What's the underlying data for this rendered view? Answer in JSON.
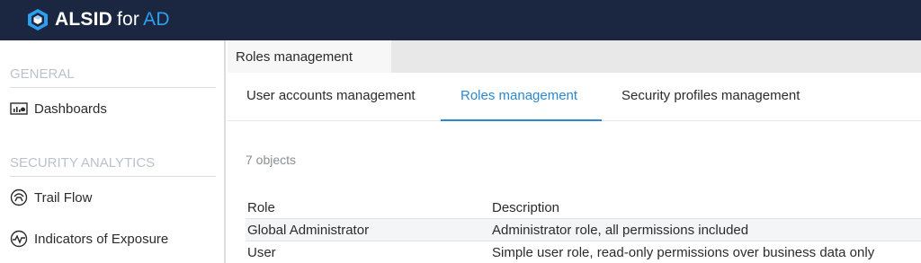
{
  "app": {
    "brand_name": "ALSID",
    "brand_for": "for",
    "brand_ad": "AD",
    "accent_color": "#2d9ff0",
    "topbar_color": "#1b2741"
  },
  "sidebar": {
    "sections": [
      {
        "title": "GENERAL"
      },
      {
        "title": "SECURITY ANALYTICS"
      }
    ],
    "items": [
      {
        "label": "Dashboards",
        "icon": "dashboard-icon"
      },
      {
        "label": "Trail Flow",
        "icon": "trail-flow-icon"
      },
      {
        "label": "Indicators of Exposure",
        "icon": "pulse-icon"
      }
    ]
  },
  "page": {
    "tab_label": "Roles management"
  },
  "subtabs": [
    {
      "label": "User accounts management",
      "active": false
    },
    {
      "label": "Roles management",
      "active": true
    },
    {
      "label": "Security profiles management",
      "active": false
    }
  ],
  "table": {
    "count_label": "7 objects",
    "columns": [
      "Role",
      "Description"
    ],
    "rows": [
      {
        "role": "Global Administrator",
        "description": "Administrator role, all permissions included"
      },
      {
        "role": "User",
        "description": "Simple user role, read-only permissions over business data only"
      }
    ]
  }
}
